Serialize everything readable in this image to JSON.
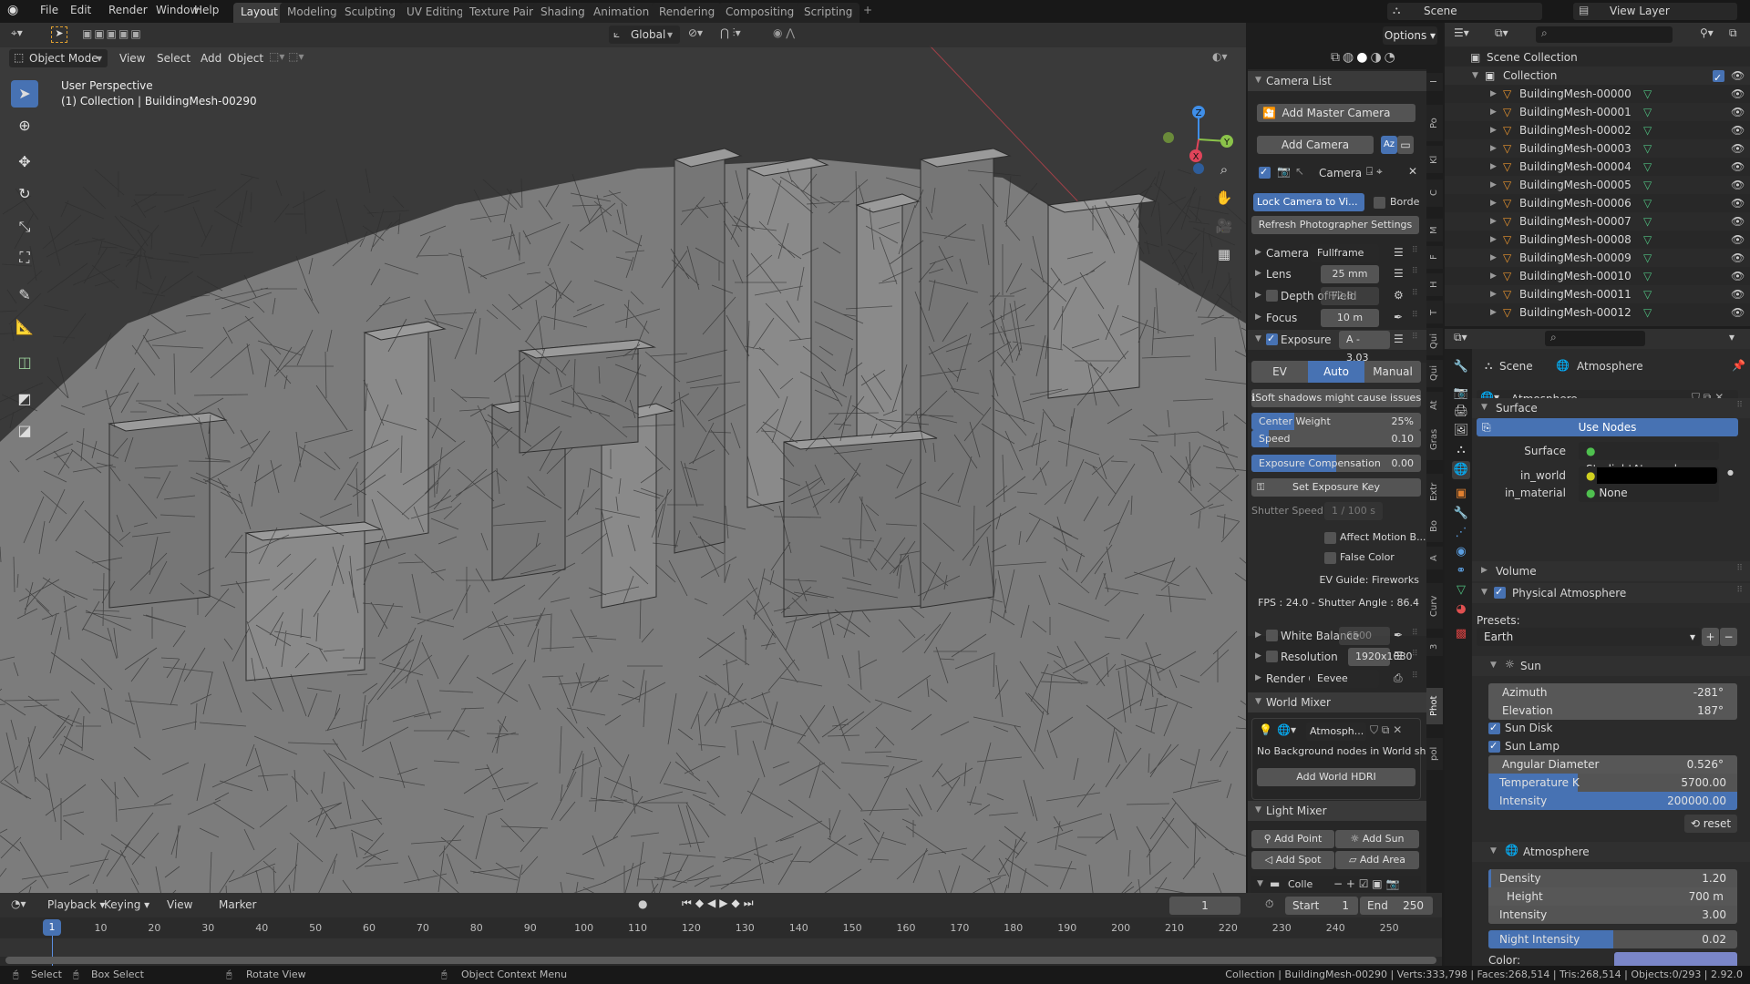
{
  "topbar": {
    "menus": [
      "File",
      "Edit",
      "Render",
      "Window",
      "Help"
    ],
    "workspaces": [
      "Layout",
      "Modeling",
      "Sculpting",
      "UV Editing",
      "Texture Paint",
      "Shading",
      "Animation",
      "Rendering",
      "Compositing",
      "Scripting"
    ],
    "active_workspace": "Layout",
    "add_workspace": "+",
    "scene": "Scene",
    "view_layer": "View Layer"
  },
  "tool_header": {
    "orientation": "Global",
    "options": "Options"
  },
  "viewport_header": {
    "mode": "Object Mode",
    "menus": [
      "View",
      "Select",
      "Add",
      "Object"
    ]
  },
  "viewport": {
    "perspective": "User Perspective",
    "active": "(1) Collection | BuildingMesh-00290",
    "gizmo": {
      "x": "X",
      "y": "Y",
      "z": "Z"
    },
    "colors": {
      "mesh": "#7c7c7c",
      "wire": "#2e2e2e",
      "background": "#3a3a3a",
      "x_axis": "#e0445a",
      "y_axis": "#8bc34a",
      "z_axis": "#3f8ee8"
    }
  },
  "npanel": {
    "camera_list": {
      "title": "Camera List",
      "add_master": "Add Master Camera",
      "add_camera": "Add Camera",
      "camera_name": "Camera",
      "lock_camera": "Lock Camera to Vi...",
      "border": "Borde",
      "refresh": "Refresh Photographer Settings"
    },
    "camera": {
      "label": "Camera",
      "value": "Fullframe"
    },
    "lens": {
      "label": "Lens",
      "value": "25 mm"
    },
    "dof": {
      "label": "Depth of Field",
      "value": "F/2.8"
    },
    "focus": {
      "label": "Focus",
      "value": "10 m"
    },
    "exposure": {
      "label": "Exposure",
      "value": "A - 3.03 EV",
      "modes": [
        "EV",
        "Auto",
        "Manual"
      ],
      "active_mode": "Auto",
      "warning": "Soft shadows might cause issues",
      "center_weight": {
        "label": "Center Weight",
        "value": "25%",
        "fraction": 0.25
      },
      "speed": {
        "label": "Speed",
        "value": "0.10",
        "fraction": 0.1
      },
      "compensation": {
        "label": "Exposure Compensation",
        "value": "0.00",
        "fraction": 0.5
      },
      "set_key": "Set Exposure Key",
      "shutter": {
        "label": "Shutter Speed",
        "value": "1 / 100 s"
      },
      "affect_motion": "Affect Motion B...",
      "false_color": "False Color",
      "ev_guide": "EV Guide: Fireworks",
      "fps": "FPS : 24.0 - Shutter Angle : 86.4"
    },
    "white_balance": {
      "label": "White Balance",
      "value": "6500"
    },
    "resolution": {
      "label": "Resolution",
      "value": "1920x1080"
    },
    "render_q": {
      "label": "Render Q",
      "value": "Eevee"
    },
    "world_mixer": {
      "title": "World Mixer",
      "world": "Atmosph...",
      "note": "No Background nodes in World sh...",
      "add_hdri": "Add World HDRI"
    },
    "light_mixer": {
      "title": "Light Mixer",
      "add_point": "Add Point",
      "add_sun": "Add Sun",
      "add_spot": "Add Spot",
      "add_area": "Add Area",
      "collection": "Colle"
    },
    "tabs": [
      "I",
      "Po",
      "Kl",
      "C",
      "M",
      "F",
      "H",
      "T",
      "Qui",
      "Qui",
      "At",
      "Gras",
      "Extr",
      "Bo",
      "A",
      "Curv",
      "3",
      "Phot",
      "pol"
    ],
    "active_tab": "Phot"
  },
  "outliner": {
    "root": "Scene Collection",
    "collection": "Collection",
    "items": [
      "BuildingMesh-00000",
      "BuildingMesh-00001",
      "BuildingMesh-00002",
      "BuildingMesh-00003",
      "BuildingMesh-00004",
      "BuildingMesh-00005",
      "BuildingMesh-00006",
      "BuildingMesh-00007",
      "BuildingMesh-00008",
      "BuildingMesh-00009",
      "BuildingMesh-00010",
      "BuildingMesh-00011",
      "BuildingMesh-00012"
    ]
  },
  "properties": {
    "breadcrumb": [
      "Scene",
      "Atmosphere"
    ],
    "world_name": "Atmosphere",
    "surface_panel": "Surface",
    "use_nodes": "Use Nodes",
    "surface": {
      "label": "Surface",
      "value": "StarlightAtmosphere"
    },
    "in_world": {
      "label": "in_world",
      "color": "#000000"
    },
    "in_material": {
      "label": "in_material",
      "value": "None"
    },
    "volume": "Volume",
    "physical_atmosphere": "Physical Atmosphere",
    "presets_label": "Presets:",
    "preset": "Earth",
    "sun": {
      "title": "Sun",
      "azimuth": {
        "label": "Azimuth",
        "value": "-281°"
      },
      "elevation": {
        "label": "Elevation",
        "value": "187°"
      },
      "sun_disk": "Sun Disk",
      "sun_lamp": "Sun Lamp",
      "angular_diameter": {
        "label": "Angular Diameter",
        "value": "0.526°"
      },
      "temperature": {
        "label": "Temperature K",
        "value": "5700.00",
        "fraction": 0.36
      },
      "intensity": {
        "label": "Intensity",
        "value": "200000.00",
        "fraction": 1.0
      },
      "reset": "reset"
    },
    "atmosphere": {
      "title": "Atmosphere",
      "density": {
        "label": "Density",
        "value": "1.20",
        "fraction": 0.01
      },
      "height": {
        "label": "Height",
        "value": "700 m"
      },
      "intensity": {
        "label": "Intensity",
        "value": "3.00",
        "fraction": 0.0
      },
      "night_intensity": {
        "label": "Night Intensity",
        "value": "0.02",
        "fraction": 0.5
      },
      "color_label": "Color:",
      "color": "#7a86c8"
    }
  },
  "timeline": {
    "menus": [
      "Playback",
      "Keying",
      "View",
      "Marker"
    ],
    "current_frame": "1",
    "start_label": "Start",
    "start": "1",
    "end_label": "End",
    "end": "250",
    "ticks": [
      "10",
      "20",
      "30",
      "40",
      "50",
      "60",
      "70",
      "80",
      "90",
      "100",
      "110",
      "120",
      "130",
      "140",
      "150",
      "160",
      "170",
      "180",
      "190",
      "200",
      "210",
      "220",
      "230",
      "240",
      "250"
    ]
  },
  "status": {
    "select": "Select",
    "box_select": "Box Select",
    "rotate": "Rotate View",
    "context": "Object Context Menu",
    "stats": "Collection | BuildingMesh-00290 | Verts:333,798 | Faces:268,514 | Tris:268,514 | Objects:0/293 | 2.92.0"
  }
}
